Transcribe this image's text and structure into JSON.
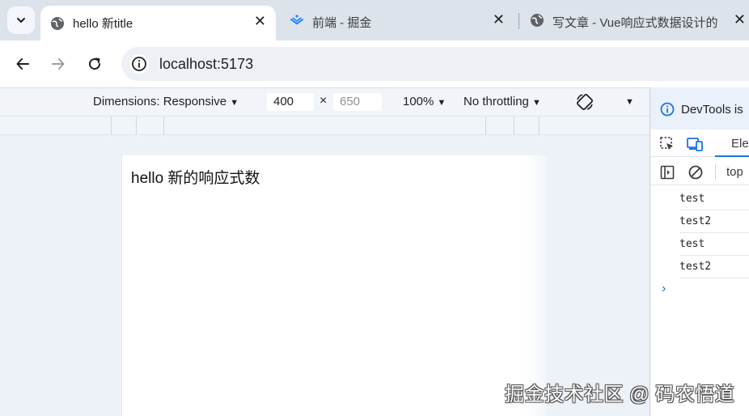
{
  "tabs": [
    {
      "title": "hello 新title",
      "close": "✕",
      "icon": "globe-icon"
    },
    {
      "title": "前端 - 掘金",
      "close": "✕",
      "icon": "juejin-logo-icon"
    },
    {
      "title": "写文章 - Vue响应式数据设计的",
      "close": "✕",
      "icon": "globe-icon"
    }
  ],
  "toolbar": {
    "url": "localhost:5173",
    "back_icon": "arrow-left-icon",
    "forward_icon": "arrow-right-icon",
    "reload_icon": "reload-icon"
  },
  "device_toolbar": {
    "dimensions": "Dimensions: Responsive",
    "width": "400",
    "separator": "×",
    "height_placeholder": "650",
    "zoom": "100%",
    "throttling": "No throttling",
    "rotate_icon": "rotate-icon",
    "more_icon": "caret-down-icon"
  },
  "page": {
    "text": "hello 新的响应式数"
  },
  "devtools": {
    "banner": "DevTools is",
    "elements_tab": "Ele",
    "context": "top",
    "console_lines": [
      "test",
      "test2",
      "test",
      "test2"
    ],
    "prompt": "›"
  },
  "watermark": "掘金技术社区 @ 码农悟道",
  "colors": {
    "tabstrip": "#dde3ea",
    "active_blue": "#1a73e8",
    "juejin_blue": "#1e80ff"
  }
}
